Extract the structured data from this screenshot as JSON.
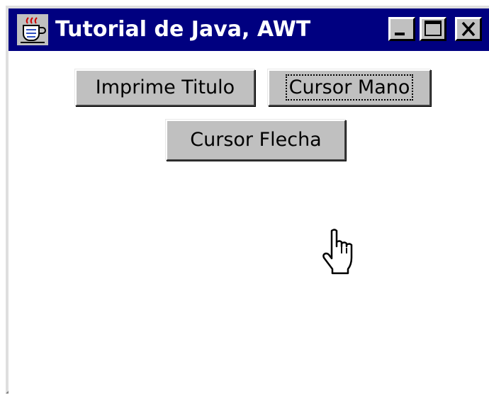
{
  "window": {
    "title": "Tutorial de Java, AWT",
    "controls": {
      "minimize": "minimize",
      "maximize": "maximize",
      "close": "close"
    }
  },
  "buttons": {
    "print_title": "Imprime Titulo",
    "hand_cursor": "Cursor Mano",
    "arrow_cursor": "Cursor Flecha"
  },
  "focused_button": "Cursor Mano",
  "icons": {
    "app": "java-coffee-cup-icon",
    "pointer": "hand-pointer-cursor-icon"
  },
  "colors": {
    "titlebar": "#000080",
    "title_text": "#ffffff",
    "button_face": "#c0c0c0",
    "client": "#ffffff"
  }
}
